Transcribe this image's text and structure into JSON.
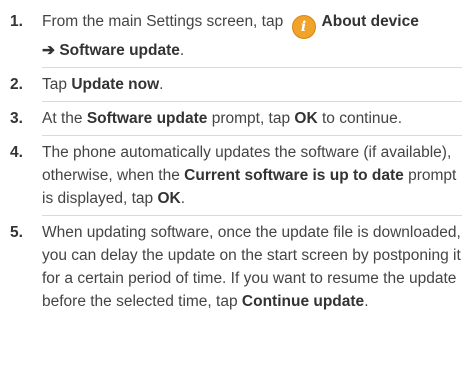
{
  "steps": [
    {
      "number": "1.",
      "parts": {
        "t1": "From the main Settings screen, tap",
        "b1": "About device",
        "arrow": "➔",
        "b2": "Software update",
        "t2": "."
      }
    },
    {
      "number": "2.",
      "parts": {
        "t1": "Tap ",
        "b1": "Update now",
        "t2": "."
      }
    },
    {
      "number": "3.",
      "parts": {
        "t1": "At the ",
        "b1": "Software update",
        "t2": " prompt, tap ",
        "b2": "OK",
        "t3": " to continue."
      }
    },
    {
      "number": "4.",
      "parts": {
        "t1": "The phone automatically updates the software (if available), otherwise, when the ",
        "b1": "Current software is up to date",
        "t2": " prompt is displayed, tap ",
        "b2": "OK",
        "t3": "."
      }
    },
    {
      "number": "5.",
      "parts": {
        "t1": "When updating software, once the update file is downloaded, you can delay the update on the start screen by postponing it for a certain period of time. If you want to resume the update before the selected time, tap ",
        "b1": "Continue update",
        "t2": "."
      }
    }
  ],
  "icons": {
    "about": {
      "name": "info-icon",
      "glyph": "i",
      "color": "#f0a22a"
    }
  }
}
